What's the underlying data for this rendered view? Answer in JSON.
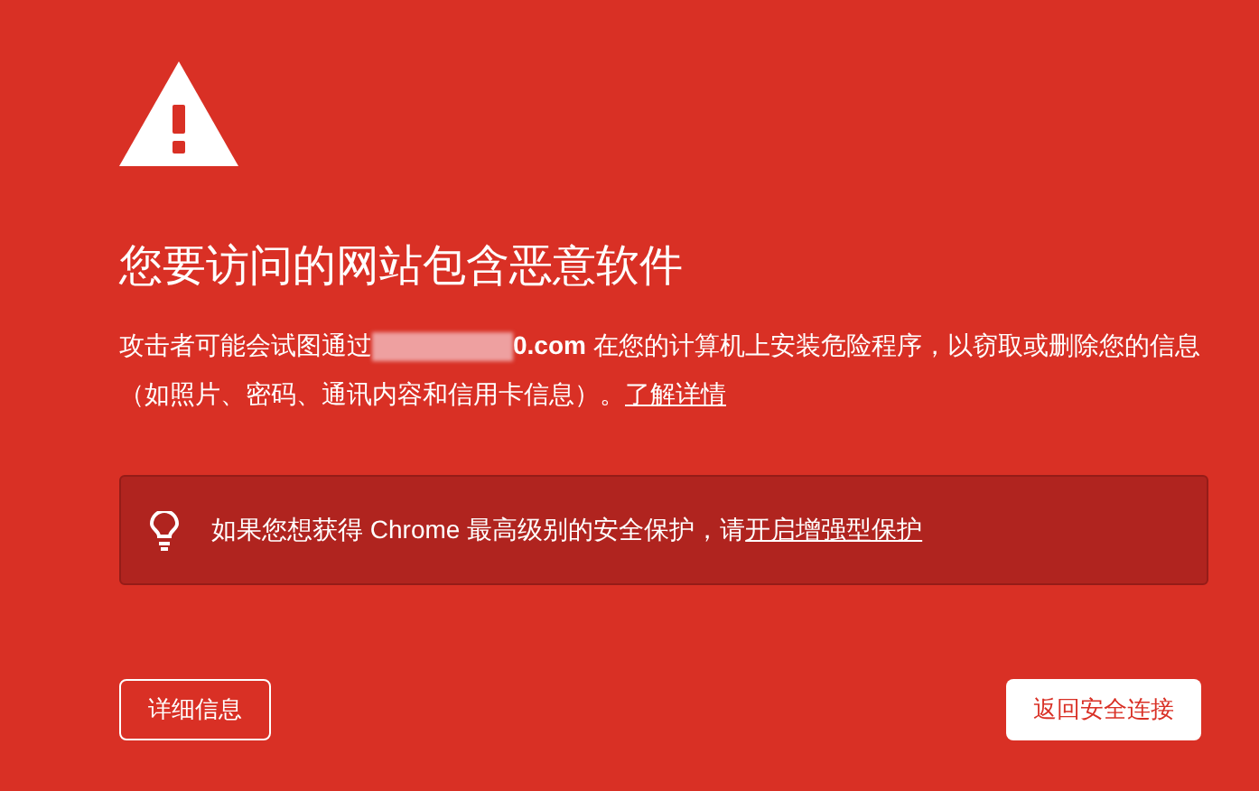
{
  "heading": "您要访问的网站包含恶意软件",
  "message": {
    "before": "攻击者可能会试图通过",
    "after": "**0.com** 在您的计算机上安装危险程序，以窃取或删除您的信息（如照片、密码、通讯内容和信用卡信息）。",
    "link": "了解详情"
  },
  "tip": {
    "text": "如果您想获得 Chrome 最高级别的安全保护，请",
    "link": "开启增强型保护"
  },
  "buttons": [
    {
      "label": "详细信息",
      "kind": "secondary"
    },
    {
      "label": "返回安全连接",
      "kind": "primary"
    }
  ]
}
